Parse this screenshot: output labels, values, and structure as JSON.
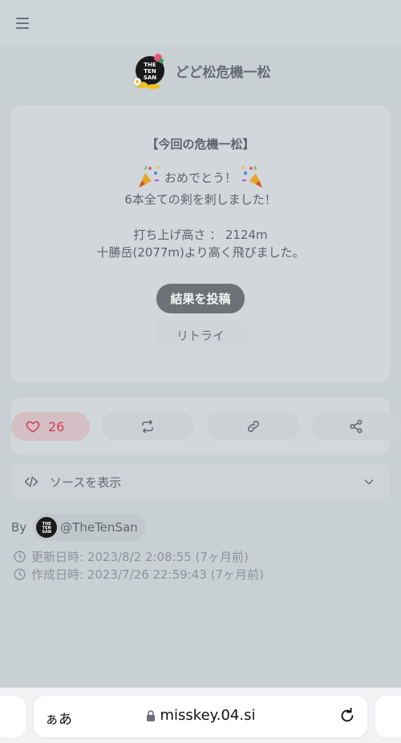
{
  "page": {
    "title": "どど松危機一松",
    "logo_text": [
      "THE",
      "TEN",
      "SAN"
    ]
  },
  "card": {
    "heading": "【今回の危機一松】",
    "congrats": "おめでとう！",
    "line1": "6本全ての剣を刺しました！",
    "line2": "打ち上げ高さ ： 2124m",
    "line3": "十勝岳(2077m)より高く飛びました。",
    "post_button": "結果を投稿",
    "retry_button": "リトライ"
  },
  "actions": {
    "like_count": "26",
    "like_color": "#d23a55"
  },
  "source": {
    "label": "ソースを表示"
  },
  "author": {
    "by_label": "By",
    "handle": "@TheTenSan"
  },
  "meta": {
    "updated": "更新日時: 2023/8/2 2:08:55 (7ヶ月前)",
    "created": "作成日時: 2023/7/26 22:59:43 (7ヶ月前)"
  },
  "browser": {
    "aa_label": "ぁあ",
    "url": "misskey.04.si"
  }
}
